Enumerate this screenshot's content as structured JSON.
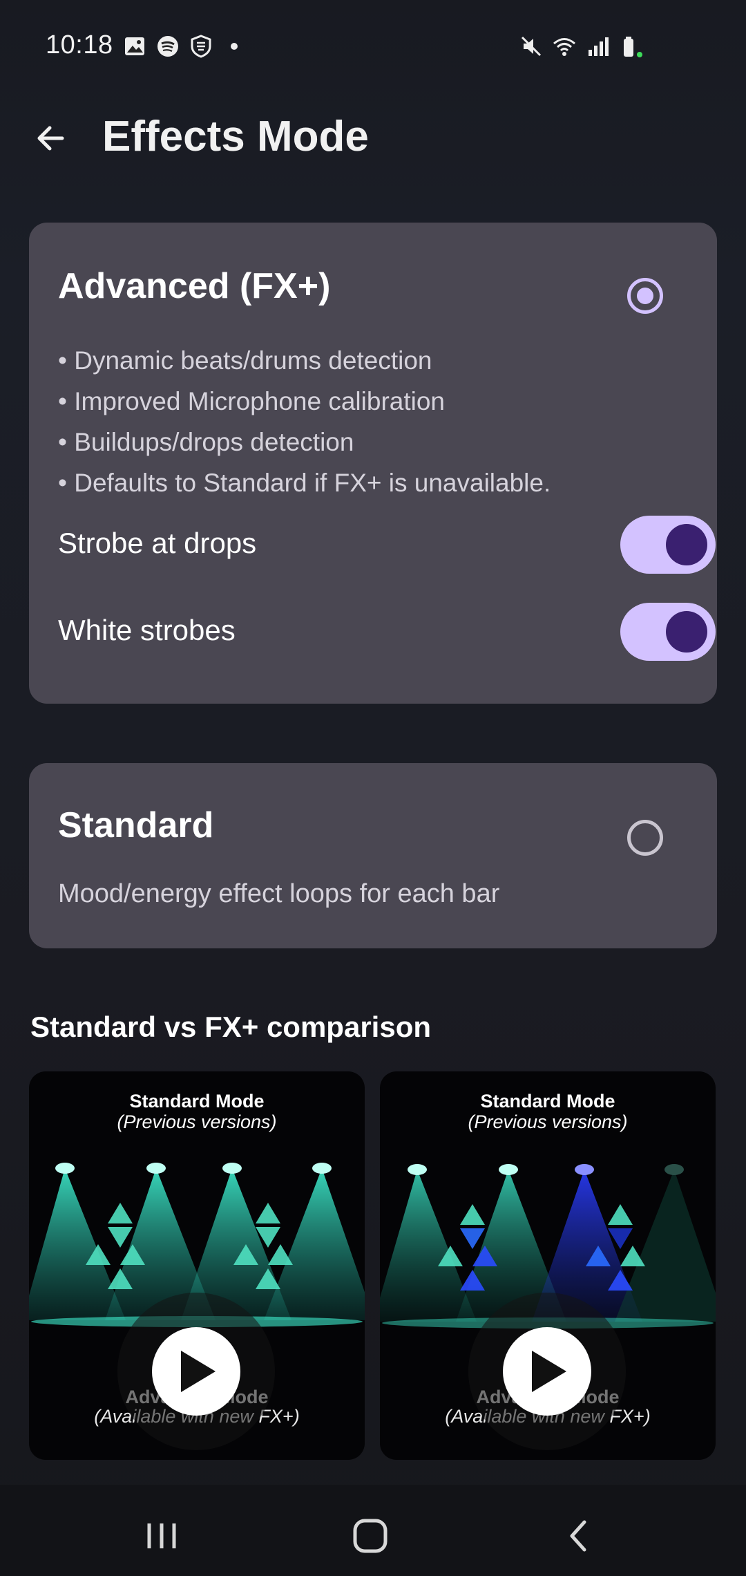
{
  "status_bar": {
    "time": "10:18",
    "left_icons": [
      "gallery-icon",
      "spotify-icon",
      "shield-icon",
      "dot-icon"
    ],
    "right_icons": [
      "mute-icon",
      "wifi-icon",
      "signal-icon",
      "battery-icon"
    ]
  },
  "header": {
    "title": "Effects Mode"
  },
  "advanced_card": {
    "title": "Advanced (FX+)",
    "selected": true,
    "features": [
      "• Dynamic beats/drums detection",
      "• Improved Microphone calibration",
      "• Buildups/drops detection",
      "• Defaults to Standard if FX+ is unavailable."
    ],
    "toggles": [
      {
        "label": "Strobe at drops",
        "on": true
      },
      {
        "label": "White strobes",
        "on": true
      }
    ]
  },
  "standard_card": {
    "title": "Standard",
    "selected": false,
    "description": "Mood/energy effect loops for each bar"
  },
  "comparison": {
    "title": "Standard vs FX+ comparison",
    "videos": [
      {
        "title": "Standard Mode",
        "subtitle": "(Previous versions)",
        "adv_title": "Advanced Mode",
        "adv_subtitle": "(Available with new FX+)"
      },
      {
        "title": "Standard Mode",
        "subtitle": "(Previous versions)",
        "adv_title": "Advanced Mode",
        "adv_subtitle": "(Available with new FX+)"
      }
    ]
  },
  "colors": {
    "accent": "#d3c2ff",
    "toggle_thumb": "#3a2070",
    "card_bg": "#4a4752",
    "page_bg": "#1b1e27"
  },
  "nav_bar": {
    "buttons": [
      "recents-icon",
      "home-icon",
      "back-icon"
    ]
  }
}
